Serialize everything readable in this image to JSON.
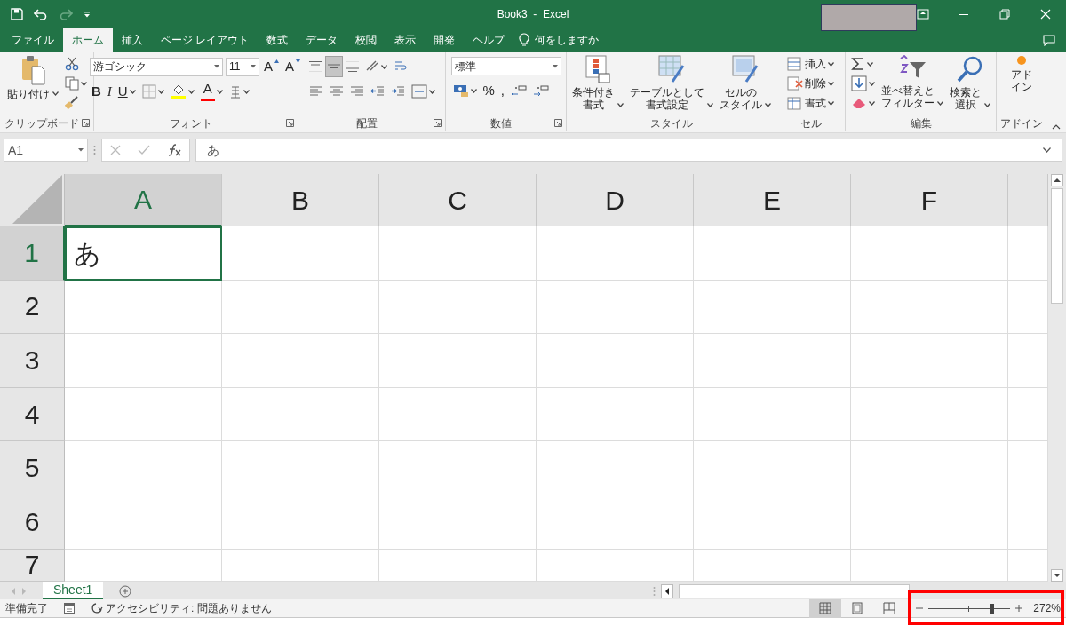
{
  "window": {
    "title": "Book3  -  Excel"
  },
  "ribbon_tabs": [
    {
      "label": "ファイル",
      "selected": false
    },
    {
      "label": "ホーム",
      "selected": true
    },
    {
      "label": "挿入",
      "selected": false
    },
    {
      "label": "ページ レイアウト",
      "selected": false
    },
    {
      "label": "数式",
      "selected": false
    },
    {
      "label": "データ",
      "selected": false
    },
    {
      "label": "校閲",
      "selected": false
    },
    {
      "label": "表示",
      "selected": false
    },
    {
      "label": "開発",
      "selected": false
    },
    {
      "label": "ヘルプ",
      "selected": false
    }
  ],
  "tell_me": "何をしますか",
  "ribbon_groups": [
    {
      "label": "クリップボード",
      "launcher": true,
      "columns": [
        {
          "kind": "large",
          "lines": [
            "貼り付け"
          ],
          "dropdown": true
        },
        {
          "kind": "stack",
          "items": [
            {
              "kind": "icon"
            },
            {
              "kind": "icon",
              "dropdown": true
            },
            {
              "kind": "icon"
            }
          ]
        }
      ]
    },
    {
      "label": "フォント",
      "launcher": true,
      "columns": [
        {
          "kind": "rows",
          "top": [
            {
              "kind": "combo",
              "value": "游ゴシック"
            },
            {
              "kind": "combo",
              "value": "11"
            },
            {
              "kind": "glyph",
              "label": "A"
            },
            {
              "kind": "glyph",
              "label": "A"
            }
          ],
          "bottom": [
            {
              "kind": "glyph",
              "label": "B"
            },
            {
              "kind": "glyph",
              "label": "I"
            },
            {
              "kind": "glyph",
              "label": "U",
              "dropdown": true
            },
            {
              "kind": "icon",
              "dropdown": true
            },
            {
              "kind": "icon",
              "dropdown": true
            },
            {
              "kind": "glyph",
              "label": "A",
              "dropdown": true
            },
            {
              "kind": "icon",
              "dropdown": true
            }
          ]
        }
      ]
    },
    {
      "label": "配置",
      "launcher": true,
      "columns": [
        {
          "kind": "rows",
          "top": [
            {
              "kind": "icon",
              "selected": false
            },
            {
              "kind": "icon",
              "selected": true
            },
            {
              "kind": "icon",
              "selected": false
            },
            {
              "kind": "icon",
              "selected": false,
              "dropdown": true
            },
            {
              "kind": "icon",
              "selected": false
            }
          ],
          "bottom": [
            {
              "kind": "icon",
              "selected": false
            },
            {
              "kind": "icon",
              "selected": false
            },
            {
              "kind": "icon",
              "selected": false
            },
            {
              "kind": "icon",
              "selected": false
            },
            {
              "kind": "icon",
              "selected": false
            },
            {
              "kind": "icon",
              "selected": false,
              "dropdown": true
            }
          ]
        }
      ]
    },
    {
      "label": "数値",
      "launcher": true,
      "columns": [
        {
          "kind": "rows",
          "top": [
            {
              "kind": "combo",
              "value": "標準"
            }
          ],
          "bottom": [
            {
              "kind": "icon",
              "dropdown": true
            },
            {
              "kind": "glyph",
              "label": "%"
            },
            {
              "kind": "glyph",
              "label": ","
            },
            {
              "kind": "icon"
            },
            {
              "kind": "icon"
            }
          ]
        }
      ]
    },
    {
      "label": "スタイル",
      "columns": [
        {
          "kind": "large",
          "lines": [
            "条件付き",
            "書式"
          ],
          "dropdown": true
        },
        {
          "kind": "large",
          "lines": [
            "テーブルとして",
            "書式設定"
          ],
          "dropdown": true
        },
        {
          "kind": "large",
          "lines": [
            "セルの",
            "スタイル"
          ],
          "dropdown": true
        }
      ]
    },
    {
      "label": "セル",
      "columns": [
        {
          "kind": "stack",
          "items": [
            {
              "kind": "labeled",
              "label": "挿入",
              "dropdown": true
            },
            {
              "kind": "labeled",
              "label": "削除",
              "dropdown": true
            },
            {
              "kind": "labeled",
              "label": "書式",
              "dropdown": true
            }
          ]
        }
      ]
    },
    {
      "label": "編集",
      "columns": [
        {
          "kind": "stack",
          "items": [
            {
              "kind": "icon",
              "dropdown": true
            },
            {
              "kind": "icon",
              "dropdown": true
            },
            {
              "kind": "icon",
              "dropdown": true
            }
          ]
        },
        {
          "kind": "large",
          "lines": [
            "並べ替えと",
            "フィルター"
          ],
          "dropdown": true
        },
        {
          "kind": "large",
          "lines": [
            "検索と",
            "選択"
          ],
          "dropdown": true
        }
      ]
    },
    {
      "label": "アドイン",
      "columns": [
        {
          "kind": "large",
          "lines": [
            "アド",
            "イン"
          ]
        }
      ]
    }
  ],
  "formula_bar": {
    "name_box": "A1",
    "formula": "あ"
  },
  "grid": {
    "columns": [
      {
        "label": "A",
        "selected": true
      },
      {
        "label": "B",
        "selected": false
      },
      {
        "label": "C",
        "selected": false
      },
      {
        "label": "D",
        "selected": false
      },
      {
        "label": "E",
        "selected": false
      },
      {
        "label": "F",
        "selected": false
      }
    ],
    "rows": [
      {
        "label": "1",
        "selected": true,
        "cells": [
          {
            "value": "あ",
            "selected": true
          }
        ]
      },
      {
        "label": "2",
        "selected": false
      },
      {
        "label": "3",
        "selected": false
      },
      {
        "label": "4",
        "selected": false
      },
      {
        "label": "5",
        "selected": false
      },
      {
        "label": "6",
        "selected": false
      },
      {
        "label": "7",
        "selected": false
      }
    ]
  },
  "sheet_tabs": [
    {
      "label": "Sheet1",
      "selected": true
    }
  ],
  "status_bar": {
    "status": "準備完了",
    "accessibility": "アクセシビリティ: 問題ありません",
    "views": [
      {
        "selected": true
      },
      {
        "selected": false
      },
      {
        "selected": false
      }
    ],
    "zoom": {
      "level": 0.77,
      "reading": "272%"
    }
  }
}
